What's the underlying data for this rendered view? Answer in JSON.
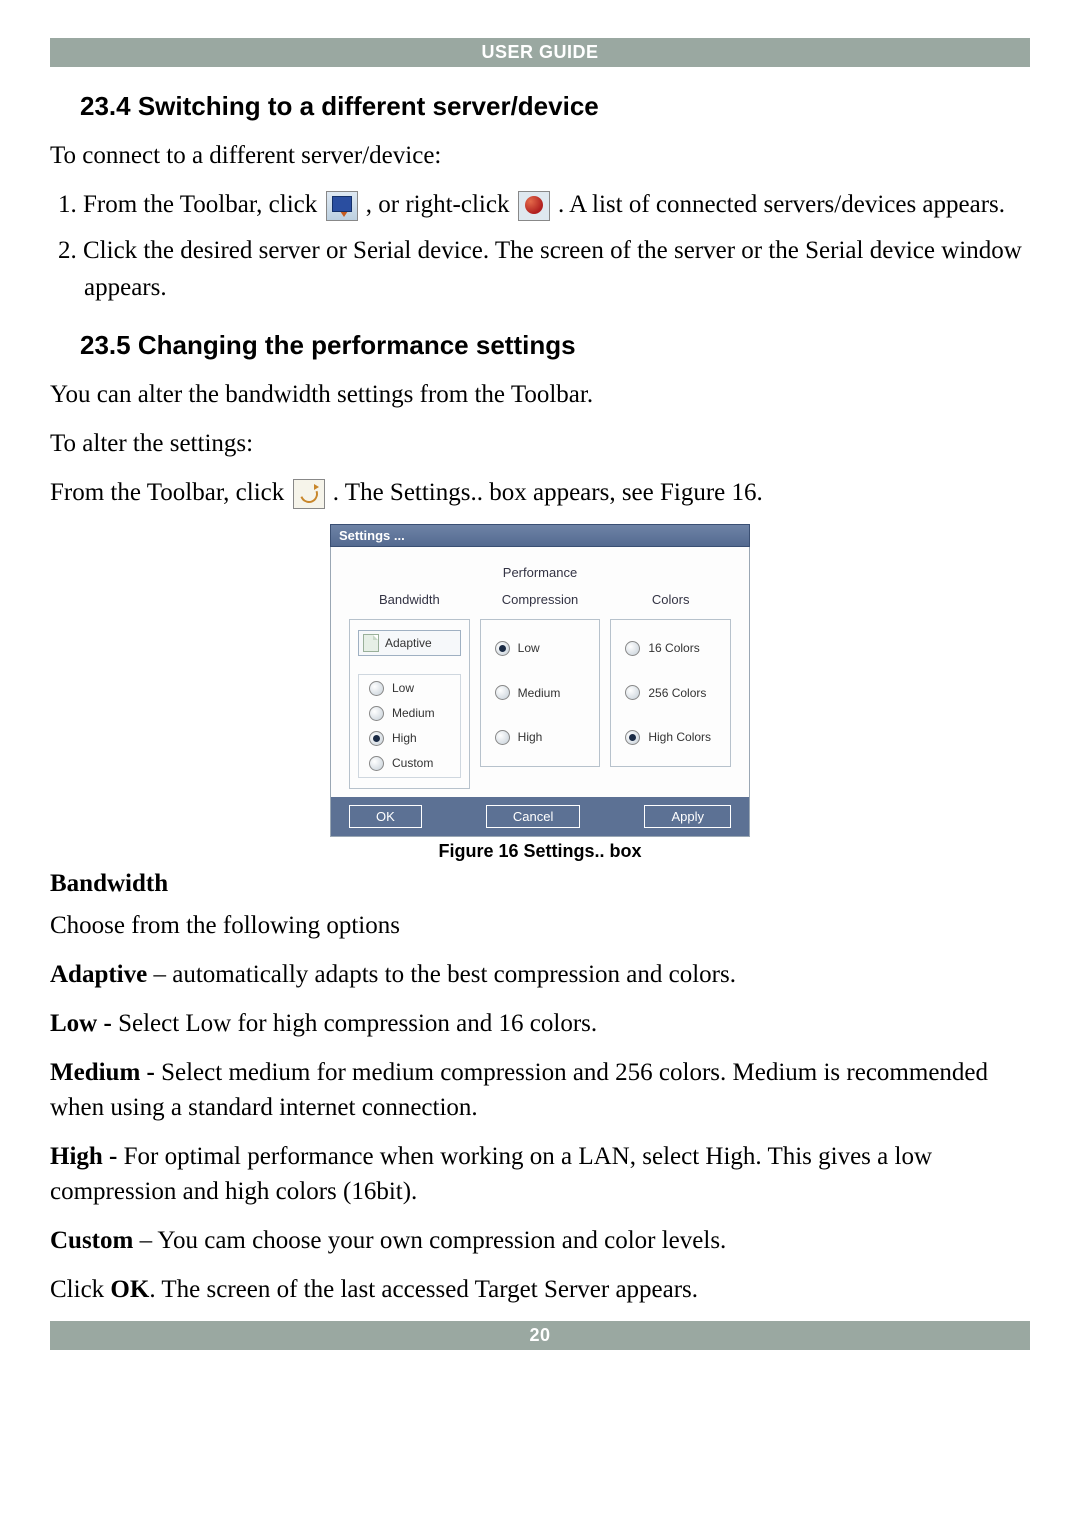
{
  "header": {
    "title": "USER GUIDE"
  },
  "footer": {
    "page": "20"
  },
  "section_234": {
    "heading": "23.4 Switching to a different server/device",
    "intro": "To connect to a different server/device:",
    "step1_a": "1. From the Toolbar, click ",
    "step1_b": ", or right-click ",
    "step1_c": ". A list of connected servers/devices appears.",
    "step2": "2. Click the desired server or Serial device. The screen of the server or the Serial device window appears."
  },
  "section_235": {
    "heading": "23.5 Changing the performance settings",
    "p1": "You can alter the bandwidth settings from the Toolbar.",
    "p2": "To alter the settings:",
    "p3_a": "From the Toolbar, click ",
    "p3_b": ". The Settings.. box appears, see Figure 16."
  },
  "dialog": {
    "title": "Settings ...",
    "tab": "Performance",
    "col_bandwidth": "Bandwidth",
    "col_compression": "Compression",
    "col_colors": "Colors",
    "bw_adaptive": "Adaptive",
    "bw_low": "Low",
    "bw_medium": "Medium",
    "bw_high": "High",
    "bw_custom": "Custom",
    "cmp_low": "Low",
    "cmp_medium": "Medium",
    "cmp_high": "High",
    "clr_16": "16 Colors",
    "clr_256": "256 Colors",
    "clr_high": "High Colors",
    "btn_ok": "OK",
    "btn_cancel": "Cancel",
    "btn_apply": "Apply"
  },
  "figure_caption": "Figure 16 Settings.. box",
  "bandwidth_section": {
    "heading": "Bandwidth",
    "intro": "Choose from the following options",
    "adaptive_label": "Adaptive",
    "adaptive_text": " – automatically adapts to the best compression and colors.",
    "low_label": "Low - ",
    "low_text": "Select Low for high compression and 16 colors.",
    "medium_label": "Medium - ",
    "medium_text": "Select medium for medium compression and 256 colors. Medium is recommended when using a standard internet connection.",
    "high_label": "High - ",
    "high_text": "For optimal performance when working on a LAN, select High. This gives a low compression and high colors (16bit).",
    "custom_label": "Custom",
    "custom_text": " – You cam choose your own compression and color levels.",
    "ok_a": "Click ",
    "ok_bold": "OK",
    "ok_b": ". The screen of the last accessed Target Server appears."
  }
}
